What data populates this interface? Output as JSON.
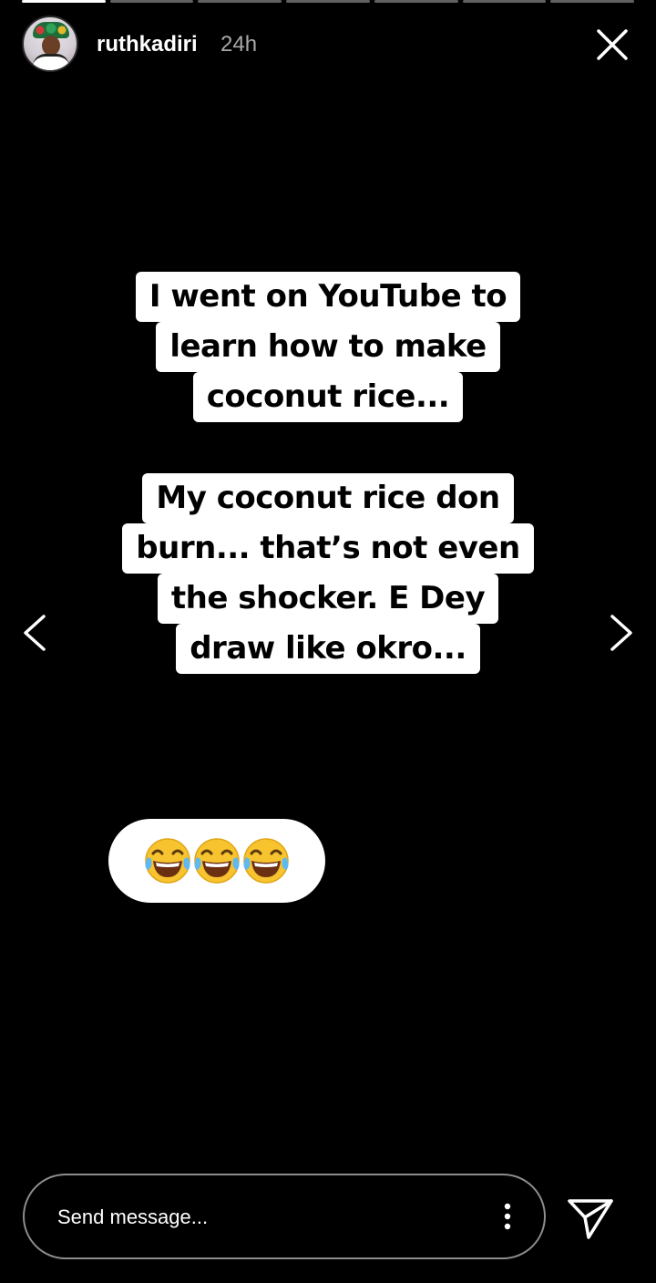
{
  "story": {
    "segment_count": 7,
    "active_segment": 0
  },
  "header": {
    "username": "ruthkadiri",
    "time": "24h",
    "avatar_icon": "profile-avatar"
  },
  "stickers": [
    {
      "lines": [
        "I went on YouTube to",
        "learn how to make",
        "coconut rice..."
      ]
    },
    {
      "lines": [
        "My coconut rice don",
        "burn... that’s not even",
        "the shocker. E Dey",
        "draw like okro..."
      ]
    }
  ],
  "emoji_bubble": {
    "emoji_name": "face-with-tears-of-joy",
    "count": 3
  },
  "reply": {
    "placeholder": "Send message..."
  },
  "colors": {
    "background": "#000000",
    "sticker_bg": "#ffffff",
    "sticker_text": "#000000",
    "time_text": "#a8a8a8"
  }
}
